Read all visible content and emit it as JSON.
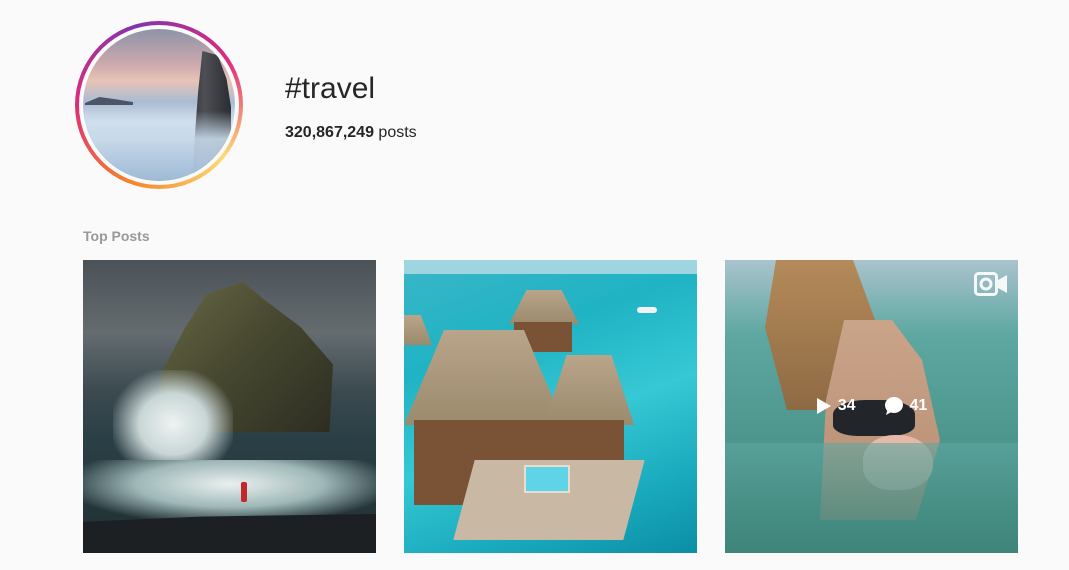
{
  "header": {
    "hashtag": "#travel",
    "post_count": "320,867,249",
    "post_count_suffix": " posts"
  },
  "section": {
    "label": "Top Posts"
  },
  "posts": [
    {
      "type": "image",
      "description_icon": "none"
    },
    {
      "type": "image",
      "description_icon": "none"
    },
    {
      "type": "video",
      "views": "34",
      "comments": "41",
      "icon": "video-camera-icon"
    }
  ],
  "colors": {
    "background": "#fafafa",
    "text": "#262626",
    "muted": "#999999"
  }
}
